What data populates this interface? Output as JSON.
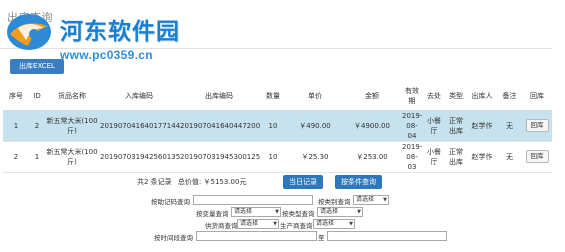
{
  "page": {
    "title": "出库查询"
  },
  "watermark": {
    "name": "河东软件园",
    "url": "www.pc0359.cn"
  },
  "toolbar": {
    "export_label": "出库EXCEL"
  },
  "table": {
    "headers": [
      "序号",
      "ID",
      "货品名称",
      "入库编码",
      "出库编码",
      "数量",
      "单价",
      "金额",
      "有效期",
      "去处",
      "类型",
      "出库人",
      "备注",
      "回库"
    ],
    "rows": [
      {
        "seq": "1",
        "id": "2",
        "name": "新五常大米(100斤)",
        "in_code": "201907041640177144",
        "out_code": "201907041640447200",
        "qty": "10",
        "price": "￥490.00",
        "amount": "￥4900.00",
        "expiry": "2019-08-04",
        "dest": "小餐厅",
        "type": "正常出库",
        "operator": "赵学作",
        "note": "无",
        "action": "回库"
      },
      {
        "seq": "2",
        "id": "1",
        "name": "新五常大米(100斤)",
        "in_code": "201907031942560135",
        "out_code": "201907031945300125",
        "qty": "10",
        "price": "￥25.30",
        "amount": "￥253.00",
        "expiry": "2019-08-03",
        "dest": "小餐厅",
        "type": "正常出库",
        "operator": "赵学作",
        "note": "无",
        "action": "回库"
      }
    ]
  },
  "summary": {
    "count_text": "共2 条记录",
    "total_text": "总价值: ￥5153.00元"
  },
  "buttons": {
    "today": "当日记录",
    "by_condition": "按条件查询"
  },
  "filters": {
    "by_code_label": "按助记码查询",
    "by_category_label": "按类别查询",
    "category_value": "请选择",
    "by_location_label": "按变量查询",
    "location_value": "请选择",
    "by_type_label": "按类型查询",
    "type_value": "请选择",
    "supplier_label": "供货商查询",
    "supplier_value": "请选择",
    "producer_label": "生产商查询",
    "producer_value": "请选择",
    "by_time_label": "按时间段查询",
    "to_label": "至"
  }
}
